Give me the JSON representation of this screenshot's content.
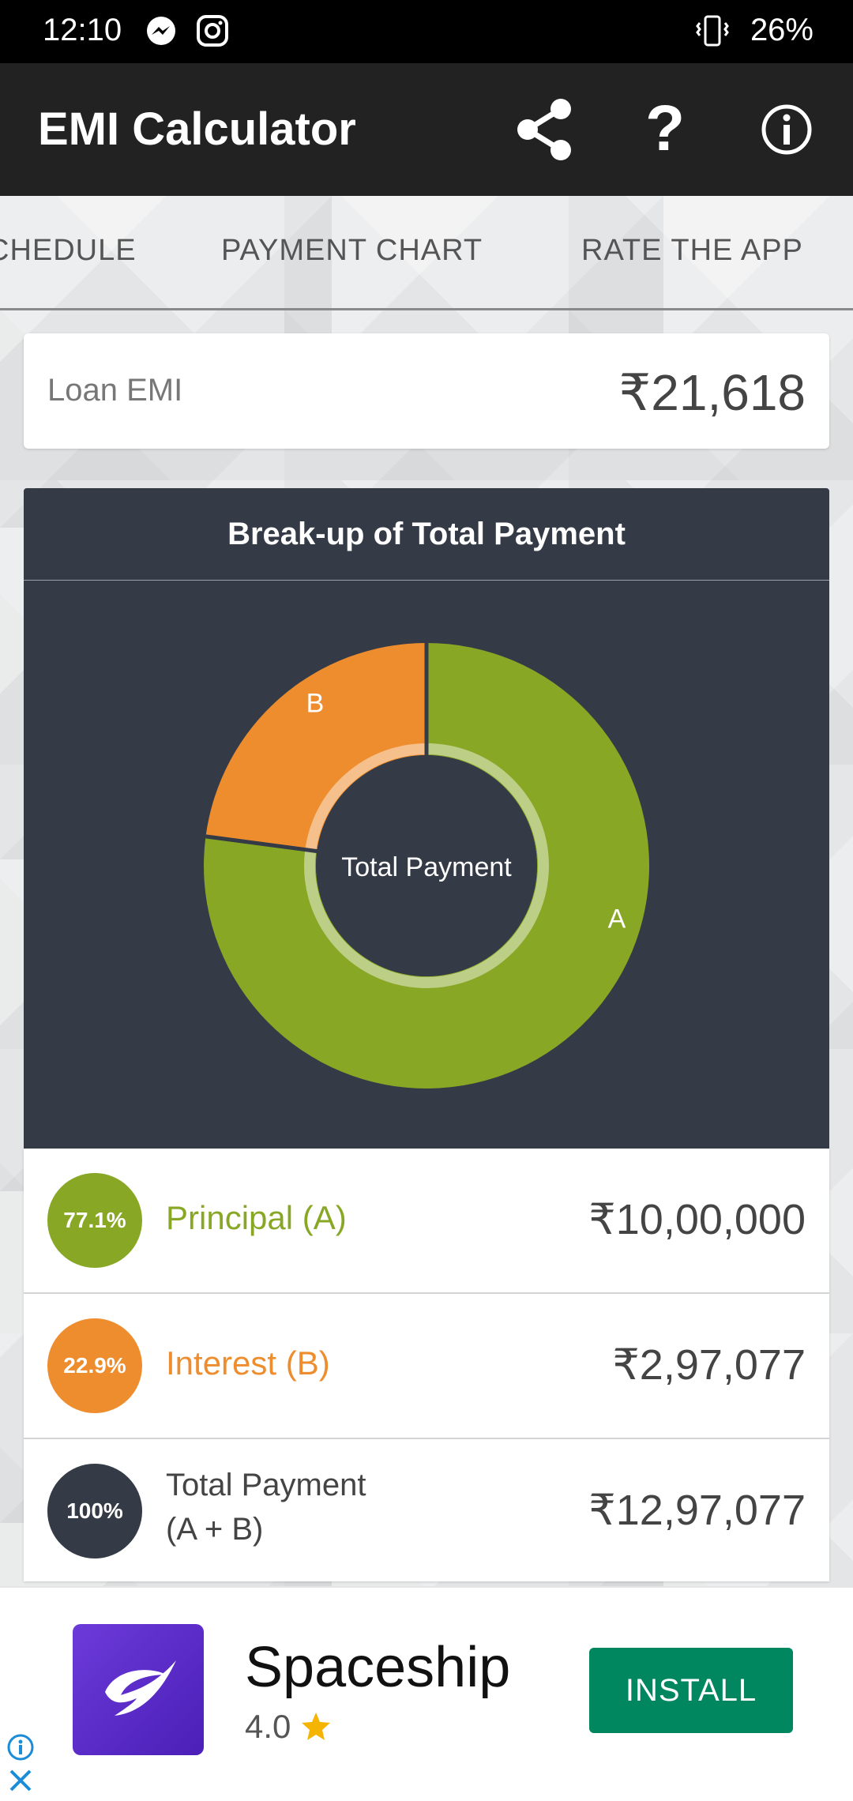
{
  "status_bar": {
    "time": "12:10",
    "battery": "26%"
  },
  "app_bar": {
    "title": "EMI Calculator"
  },
  "tabs": [
    {
      "label": "SCHEDULE",
      "visible": "CHEDULE"
    },
    {
      "label": "PAYMENT CHART"
    },
    {
      "label": "RATE THE APP"
    }
  ],
  "emi": {
    "label": "Loan EMI",
    "value": "₹21,618"
  },
  "chart": {
    "title": "Break-up of Total Payment",
    "center_label": "Total Payment"
  },
  "chart_data": {
    "type": "pie",
    "title": "Break-up of Total Payment",
    "categories": [
      "A",
      "B"
    ],
    "values": [
      77.1,
      22.9
    ],
    "colors": [
      "#88a725",
      "#ee8d2e"
    ]
  },
  "breakdown": [
    {
      "badge": "77.1%",
      "label": "Principal (A)",
      "value": "₹10,00,000",
      "color": "#88a725"
    },
    {
      "badge": "22.9%",
      "label": "Interest (B)",
      "value": "₹2,97,077",
      "color": "#ee8d2e"
    },
    {
      "badge": "100%",
      "label_line1": "Total Payment",
      "label_line2": "(A + B)",
      "value": "₹12,97,077",
      "color": "#343a46"
    }
  ],
  "ad": {
    "name": "Spaceship",
    "rating": "4.0",
    "install_label": "INSTALL"
  }
}
